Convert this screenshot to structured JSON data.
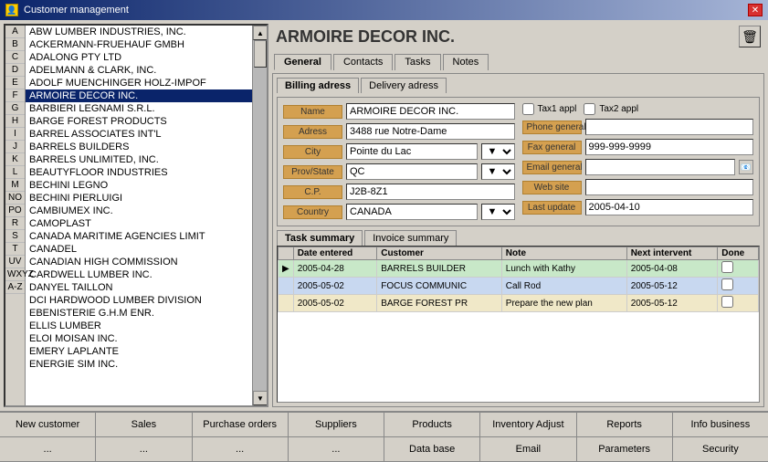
{
  "titleBar": {
    "title": "Customer management",
    "closeBtn": "✕"
  },
  "alphaItems": [
    "A",
    "B",
    "C",
    "D",
    "E",
    "F",
    "G",
    "H",
    "I",
    "J",
    "K",
    "L",
    "M",
    "NO",
    "PO",
    "R",
    "S",
    "T",
    "UV",
    "WXYZ",
    "A-Z"
  ],
  "customers": [
    {
      "name": "ABW LUMBER INDUSTRIES, INC.",
      "selected": false
    },
    {
      "name": "ACKERMANN-FRUEHAUF GMBH",
      "selected": false
    },
    {
      "name": "ADALONG PTY LTD",
      "selected": false
    },
    {
      "name": "ADELMANN & CLARK, INC.",
      "selected": false
    },
    {
      "name": "ADOLF MUENCHINGER HOLZ-IMPOF",
      "selected": false
    },
    {
      "name": "ARMOIRE DECOR INC.",
      "selected": true
    },
    {
      "name": "BARBIERI LEGNAMI S.R.L.",
      "selected": false
    },
    {
      "name": "BARGE FOREST PRODUCTS",
      "selected": false
    },
    {
      "name": "BARREL ASSOCIATES INT'L",
      "selected": false
    },
    {
      "name": "BARRELS BUILDERS",
      "selected": false
    },
    {
      "name": "BARRELS UNLIMITED, INC.",
      "selected": false
    },
    {
      "name": "BEAUTYFLOOR INDUSTRIES",
      "selected": false
    },
    {
      "name": "BECHINI LEGNO",
      "selected": false
    },
    {
      "name": "BECHINI PIERLUIGI",
      "selected": false
    },
    {
      "name": "CAMBIUMEX INC.",
      "selected": false
    },
    {
      "name": "CAMOPLAST",
      "selected": false
    },
    {
      "name": "CANADA MARITIME AGENCIES LIMIT",
      "selected": false
    },
    {
      "name": "CANADEL",
      "selected": false
    },
    {
      "name": "CANADIAN HIGH COMMISSION",
      "selected": false
    },
    {
      "name": "CARDWELL LUMBER INC.",
      "selected": false
    },
    {
      "name": "DANYEL TAILLON",
      "selected": false
    },
    {
      "name": "DCI HARDWOOD LUMBER DIVISION",
      "selected": false
    },
    {
      "name": "EBENISTERIE G.H.M ENR.",
      "selected": false
    },
    {
      "name": "ELLIS LUMBER",
      "selected": false
    },
    {
      "name": "ELOI MOISAN INC.",
      "selected": false
    },
    {
      "name": "EMERY LAPLANTE",
      "selected": false
    },
    {
      "name": "ENERGIE SIM INC.",
      "selected": false
    }
  ],
  "customerTitle": "ARMOIRE DECOR INC.",
  "tabs": [
    {
      "label": "General",
      "active": true
    },
    {
      "label": "Contacts",
      "active": false
    },
    {
      "label": "Tasks",
      "active": false
    },
    {
      "label": "Notes",
      "active": false
    }
  ],
  "subTabs": [
    {
      "label": "Billing adress",
      "active": true
    },
    {
      "label": "Delivery adress",
      "active": false
    }
  ],
  "form": {
    "nameLabel": "Name",
    "nameValue": "ARMOIRE DECOR INC.",
    "adressLabel": "Adress",
    "adressValue": "3488 rue Notre-Dame",
    "phoneGeneralLabel": "Phone general",
    "phoneGeneralValue": "",
    "cityLabel": "City",
    "cityValue": "Pointe du Lac",
    "faxGeneralLabel": "Fax general",
    "faxGeneralValue": "999-999-9999",
    "provLabel": "Prov/State",
    "provValue": "QC",
    "emailGeneralLabel": "Email general",
    "emailGeneralValue": "",
    "cpLabel": "C.P.",
    "cpValue": "J2B-8Z1",
    "webSiteLabel": "Web site",
    "webSiteValue": "",
    "countryLabel": "Country",
    "countryValue": "CANADA",
    "lastUpdateLabel": "Last update",
    "lastUpdateValue": "2005-04-10",
    "tax1Label": "Tax1 appl",
    "tax2Label": "Tax2 appl"
  },
  "taskTabs": [
    {
      "label": "Task summary",
      "active": true
    },
    {
      "label": "Invoice summary",
      "active": false
    }
  ],
  "taskTable": {
    "headers": [
      "Date entered",
      "Customer",
      "Note",
      "Next intervent",
      "Done"
    ],
    "rows": [
      {
        "arrow": "▶",
        "dateEntered": "2005-04-28",
        "customer": "BARRELS BUILDER",
        "note": "Lunch with Kathy",
        "nextIntervention": "2005-04-08",
        "done": "",
        "rowClass": "task-row-1"
      },
      {
        "arrow": "",
        "dateEntered": "2005-05-02",
        "customer": "FOCUS COMMUNIC",
        "note": "Call Rod",
        "nextIntervention": "2005-05-12",
        "done": "",
        "rowClass": "task-row-2"
      },
      {
        "arrow": "",
        "dateEntered": "2005-05-02",
        "customer": "BARGE FOREST PR",
        "note": "Prepare the new plan",
        "nextIntervention": "2005-05-12",
        "done": "",
        "rowClass": "task-row-3"
      }
    ]
  },
  "toolbar": {
    "row1": [
      {
        "label": "New customer"
      },
      {
        "label": "Sales"
      },
      {
        "label": "Purchase orders"
      },
      {
        "label": "Suppliers"
      },
      {
        "label": "Products"
      },
      {
        "label": "Inventory Adjust"
      },
      {
        "label": "Reports"
      },
      {
        "label": "Info business"
      }
    ],
    "row2": [
      {
        "label": "..."
      },
      {
        "label": "..."
      },
      {
        "label": "..."
      },
      {
        "label": "..."
      },
      {
        "label": "Data base"
      },
      {
        "label": "Email"
      },
      {
        "label": "Parameters"
      },
      {
        "label": "Security"
      }
    ]
  }
}
